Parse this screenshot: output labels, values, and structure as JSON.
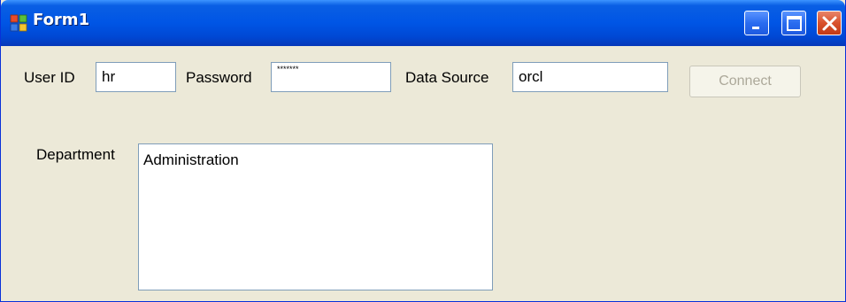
{
  "window": {
    "title": "Form1",
    "icon": "form-app-icon",
    "controls": {
      "minimize": "minimize-icon",
      "maximize": "maximize-icon",
      "close": "close-icon"
    }
  },
  "form": {
    "user_id": {
      "label": "User ID",
      "value": "hr"
    },
    "password": {
      "label": "Password",
      "masked_value": "*******"
    },
    "data_source": {
      "label": "Data Source",
      "value": "orcl"
    },
    "connect_button": {
      "label": "Connect",
      "enabled": false
    },
    "department": {
      "label": "Department",
      "items": [
        "Administration"
      ]
    }
  },
  "colors": {
    "titlebar": "#0055e5",
    "window_background": "#ece9d8",
    "close_button": "#d9512c",
    "disabled_text": "#aca899"
  }
}
